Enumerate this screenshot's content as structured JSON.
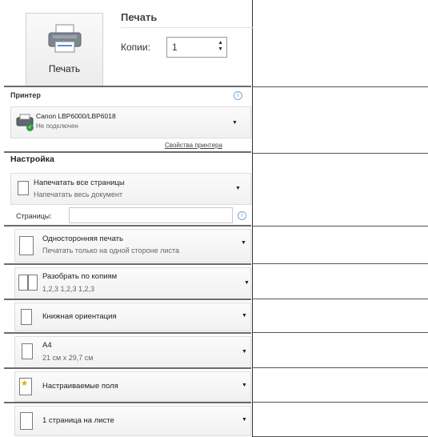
{
  "print_section": {
    "title": "Печать",
    "print_button_label": "Печать",
    "copies_label": "Копии:",
    "copies_value": "1"
  },
  "printer": {
    "header": "Принтер",
    "name": "Canon LBP6000/LBP6018",
    "status": "Не подключен",
    "properties_link": "Свойства принтера"
  },
  "settings": {
    "header": "Настройка",
    "pages_label": "Страницы:",
    "pages_value": "",
    "options": [
      {
        "title": "Напечатать все страницы",
        "subtitle": "Напечатать весь документ"
      },
      {
        "title": "Односторонняя печать",
        "subtitle": "Печатать только на одной стороне листа"
      },
      {
        "title": "Разобрать по копиям",
        "subtitle": "1,2,3   1,2,3   1,2,3"
      },
      {
        "title": "Книжная ориентация",
        "subtitle": ""
      },
      {
        "title": "А4",
        "subtitle": "21 см x 29,7 см"
      },
      {
        "title": "Настраиваемые поля",
        "subtitle": ""
      },
      {
        "title": "1 страница на листе",
        "subtitle": ""
      }
    ]
  },
  "icons": {
    "info": "info-icon",
    "dropdown": "chevron-down-icon",
    "printer": "printer-icon"
  },
  "colors": {
    "accent_link": "#4a86c5",
    "status_ok": "#2a9d3a"
  }
}
